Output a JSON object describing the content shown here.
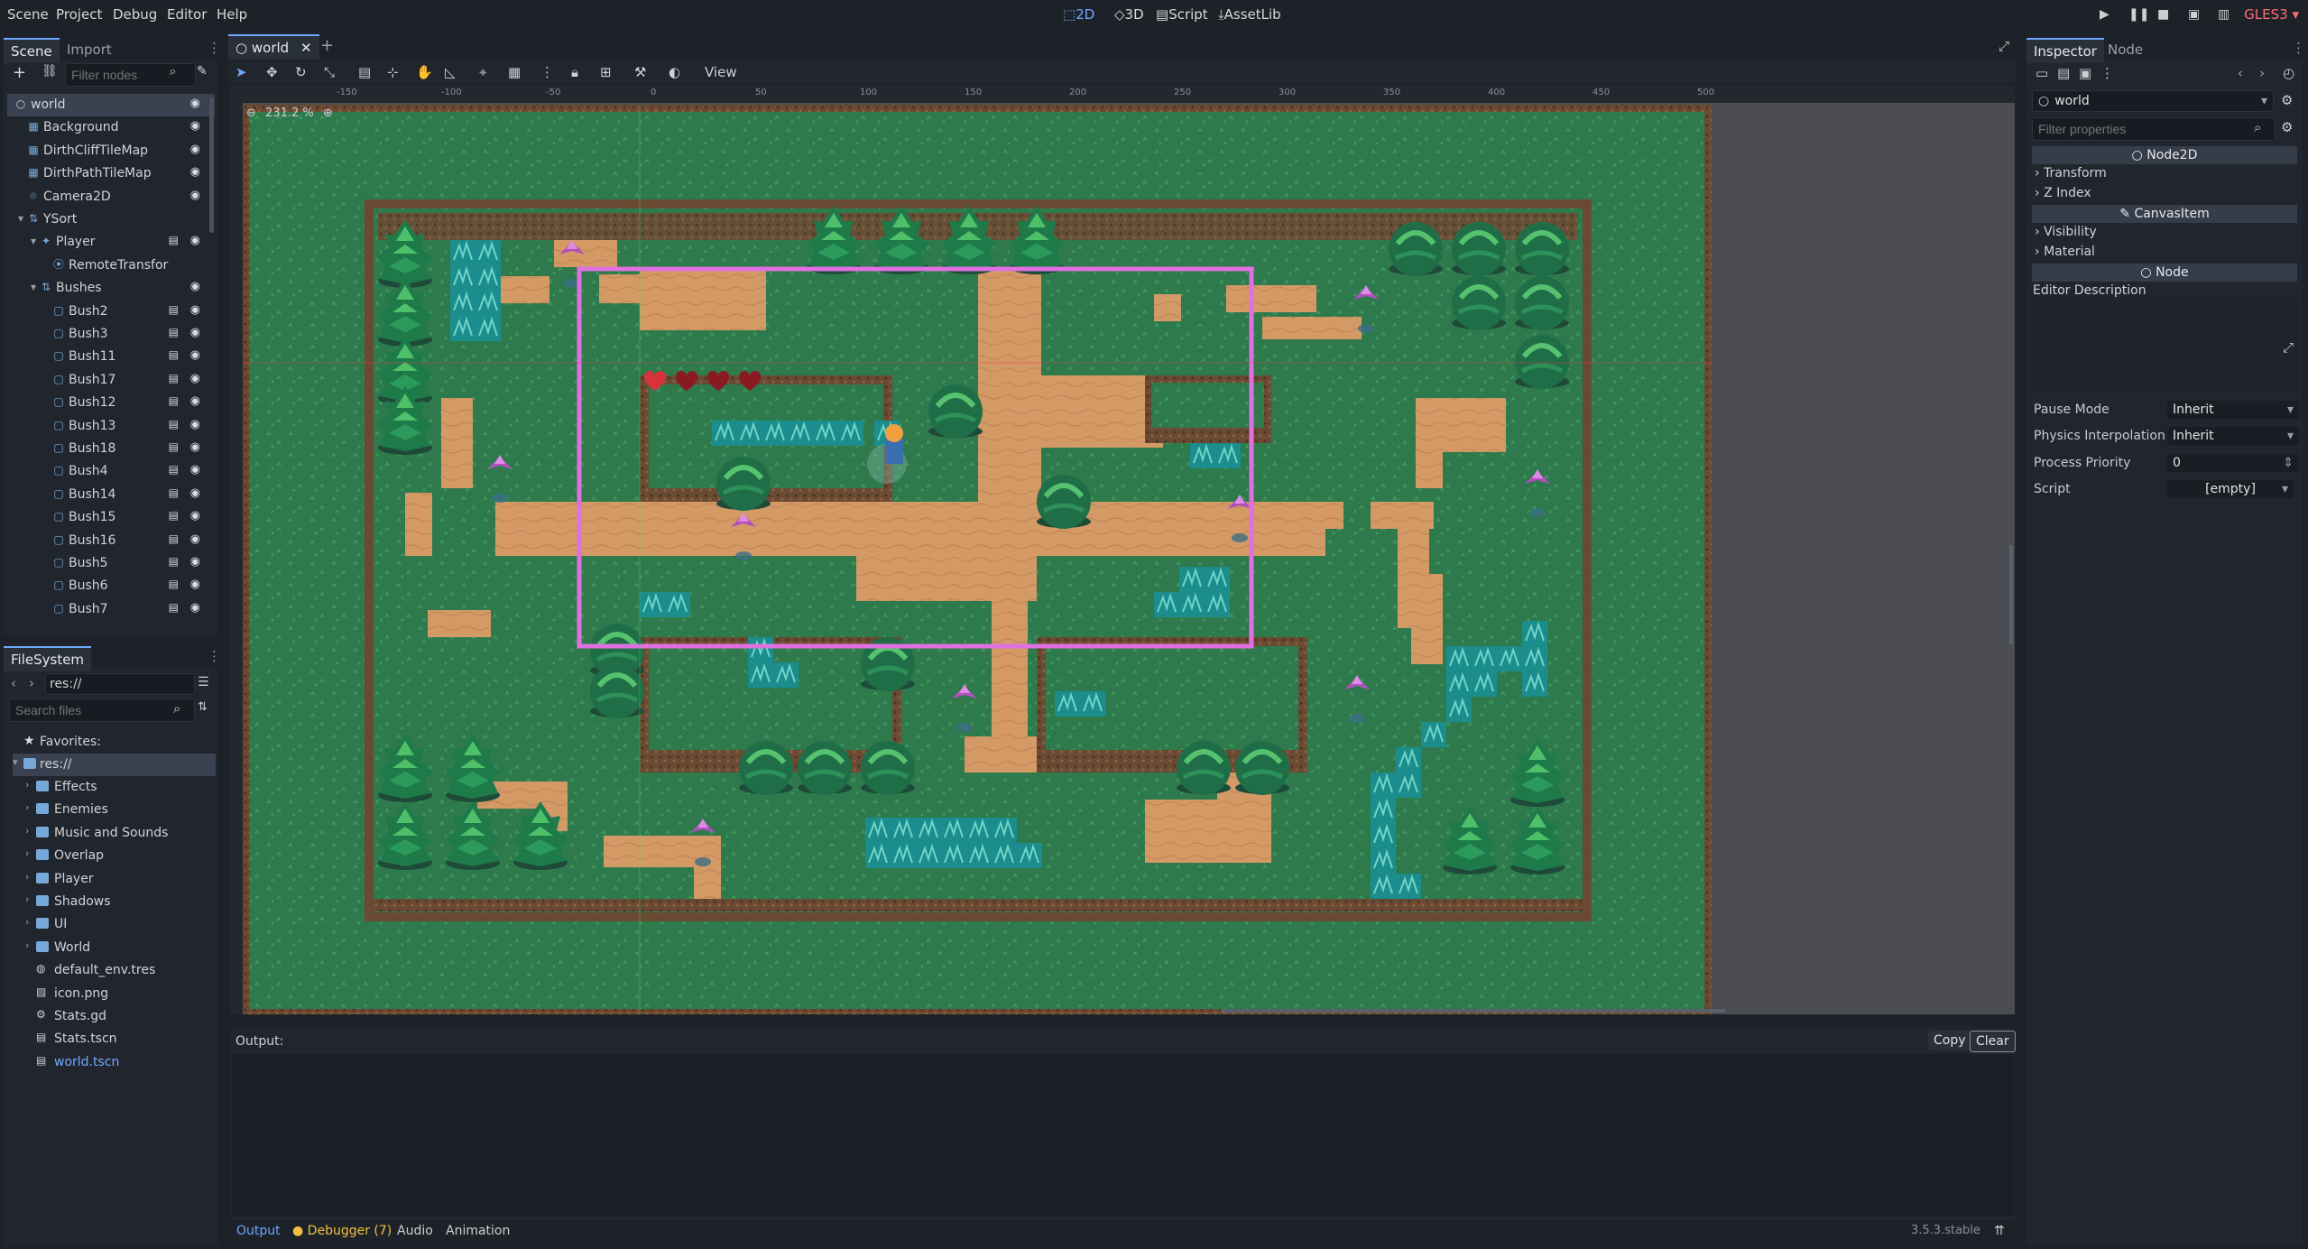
{
  "menu": [
    "Scene",
    "Project",
    "Debug",
    "Editor",
    "Help"
  ],
  "modes": {
    "m2d": "2D",
    "m3d": "3D",
    "script": "Script",
    "assetlib": "AssetLib"
  },
  "renderer": "GLES3",
  "scene_dock": {
    "tabs": [
      "Scene",
      "Import"
    ],
    "filter_placeholder": "Filter nodes",
    "nodes": [
      {
        "label": "world",
        "indent": 0
      },
      {
        "label": "Background",
        "indent": 1
      },
      {
        "label": "DirthCliffTileMap",
        "indent": 1
      },
      {
        "label": "DirthPathTileMap",
        "indent": 1
      },
      {
        "label": "Camera2D",
        "indent": 1
      },
      {
        "label": "YSort",
        "indent": 1
      },
      {
        "label": "Player",
        "indent": 2
      },
      {
        "label": "RemoteTransfor",
        "indent": 3
      },
      {
        "label": "Bushes",
        "indent": 2
      },
      {
        "label": "Bush2",
        "indent": 3
      },
      {
        "label": "Bush3",
        "indent": 3
      },
      {
        "label": "Bush11",
        "indent": 3
      },
      {
        "label": "Bush17",
        "indent": 3
      },
      {
        "label": "Bush12",
        "indent": 3
      },
      {
        "label": "Bush13",
        "indent": 3
      },
      {
        "label": "Bush18",
        "indent": 3
      },
      {
        "label": "Bush4",
        "indent": 3
      },
      {
        "label": "Bush14",
        "indent": 3
      },
      {
        "label": "Bush15",
        "indent": 3
      },
      {
        "label": "Bush16",
        "indent": 3
      },
      {
        "label": "Bush5",
        "indent": 3
      },
      {
        "label": "Bush6",
        "indent": 3
      },
      {
        "label": "Bush7",
        "indent": 3
      }
    ]
  },
  "filesystem": {
    "title": "FileSystem",
    "path": "res://",
    "search_placeholder": "Search files",
    "favorites": "Favorites:",
    "root": "res://",
    "items": [
      {
        "label": "Effects",
        "type": "folder"
      },
      {
        "label": "Enemies",
        "type": "folder"
      },
      {
        "label": "Music and Sounds",
        "type": "folder"
      },
      {
        "label": "Overlap",
        "type": "folder"
      },
      {
        "label": "Player",
        "type": "folder"
      },
      {
        "label": "Shadows",
        "type": "folder"
      },
      {
        "label": "UI",
        "type": "folder"
      },
      {
        "label": "World",
        "type": "folder"
      },
      {
        "label": "default_env.tres",
        "type": "env"
      },
      {
        "label": "icon.png",
        "type": "image"
      },
      {
        "label": "Stats.gd",
        "type": "script"
      },
      {
        "label": "Stats.tscn",
        "type": "scene"
      },
      {
        "label": "world.tscn",
        "type": "scene-active"
      }
    ]
  },
  "editor": {
    "scene_tab": "world",
    "view_menu": "View",
    "zoom": "231.2 %",
    "ruler_labels": [
      "-150",
      "-100",
      "-50",
      "0",
      "50",
      "100",
      "150",
      "200",
      "250",
      "300",
      "350",
      "400",
      "450",
      "500"
    ]
  },
  "inspector": {
    "tabs": [
      "Inspector",
      "Node"
    ],
    "object": "world",
    "filter_placeholder": "Filter properties",
    "sections": {
      "node2d": "Node2D",
      "canvas_item": "CanvasItem",
      "node": "Node"
    },
    "groups": {
      "transform": "Transform",
      "z_index": "Z Index",
      "visibility": "Visibility",
      "material": "Material"
    },
    "editor_description": "Editor Description",
    "props": [
      {
        "key": "Pause Mode",
        "value": "Inherit"
      },
      {
        "key": "Physics Interpolation",
        "value": "Inherit"
      },
      {
        "key": "Process Priority",
        "value": "0"
      },
      {
        "key": "Script",
        "value": "[empty]"
      }
    ]
  },
  "output": {
    "label": "Output:",
    "copy": "Copy",
    "clear": "Clear",
    "tabs": [
      "Output",
      "Debugger (7)",
      "Audio",
      "Animation"
    ],
    "version": "3.5.3.stable"
  }
}
